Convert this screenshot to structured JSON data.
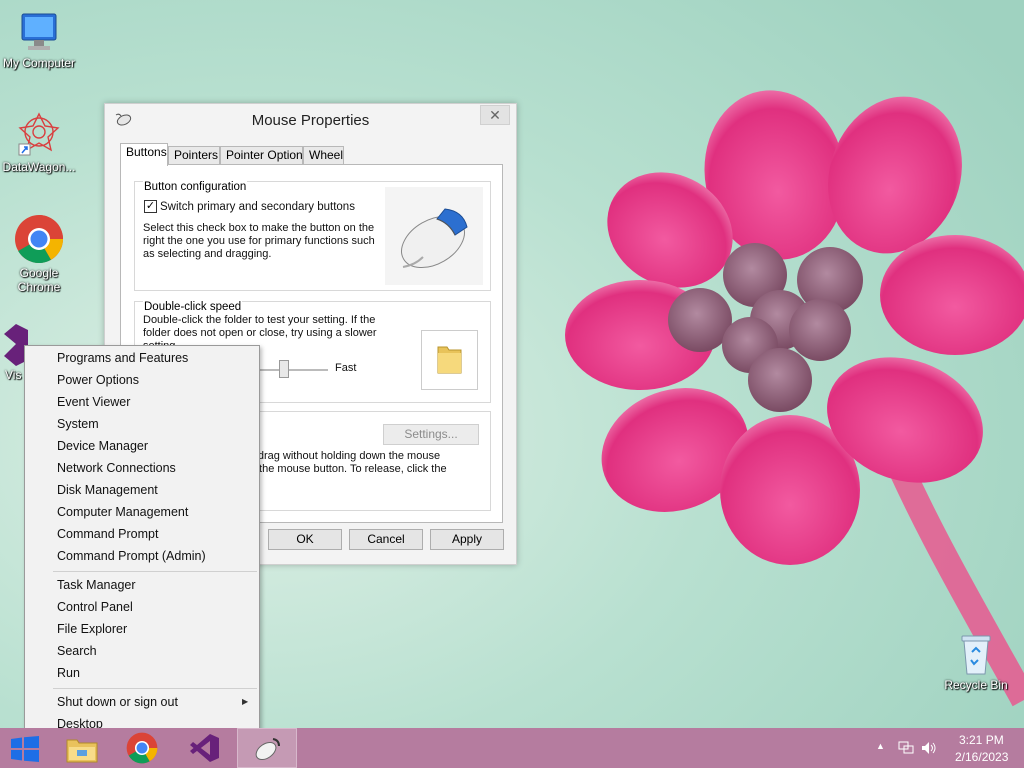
{
  "desktop": {
    "icons": [
      {
        "label": "My Computer",
        "icon": "computer-icon"
      },
      {
        "label": "DataWagon...",
        "icon": "datawagon-icon"
      },
      {
        "label": "Google Chrome",
        "label_line1": "Google",
        "label_line2": "Chrome",
        "icon": "chrome-icon"
      },
      {
        "label": "Vis",
        "icon": "visual-studio-icon"
      },
      {
        "label": "Recycle Bin",
        "icon": "recycle-bin-icon"
      }
    ]
  },
  "dialog": {
    "title": "Mouse Properties",
    "close_symbol": "✕",
    "tabs": [
      "Buttons",
      "Pointers",
      "Pointer Options",
      "Wheel"
    ],
    "active_tab": "Buttons",
    "button_config": {
      "title": "Button configuration",
      "checkbox_label": "Switch primary and secondary buttons",
      "checked": true,
      "description_line1": "Select this check box to make the button on the",
      "description_line2": "right the one you use for primary functions such",
      "description_line3": "as selecting and dragging."
    },
    "double_click": {
      "title": "Double-click speed",
      "description_line1": "Double-click the folder to test your setting. If the",
      "description_line2": "folder does not open or close, try using a slower",
      "description_line3": "setting.",
      "fast_label": "Fast"
    },
    "click_lock": {
      "settings_label": "Settings...",
      "description_line1": "or drag without holding down the mouse",
      "description_line2": "ss the mouse button. To release, click the"
    },
    "buttons": {
      "ok": "OK",
      "cancel": "Cancel",
      "apply": "Apply"
    }
  },
  "winx_menu": {
    "group1": [
      "Programs and Features",
      "Power Options",
      "Event Viewer",
      "System",
      "Device Manager",
      "Network Connections",
      "Disk Management",
      "Computer Management",
      "Command Prompt",
      "Command Prompt (Admin)"
    ],
    "group2": [
      "Task Manager",
      "Control Panel",
      "File Explorer",
      "Search",
      "Run"
    ],
    "group3": [
      "Shut down or sign out",
      "Desktop"
    ],
    "submenu_arrow": "▶"
  },
  "taskbar": {
    "pinned": [
      "start-button",
      "file-explorer-icon",
      "chrome-icon",
      "visual-studio-icon",
      "mouse-properties-icon"
    ],
    "tray_arrow": "▲",
    "time": "3:21 PM",
    "date": "2/16/2023"
  },
  "colors": {
    "taskbar": "#b57c9f",
    "wallpaper": "#a9d8c7",
    "flower": "#e0307f",
    "start_blue": "#1e6ee6"
  }
}
